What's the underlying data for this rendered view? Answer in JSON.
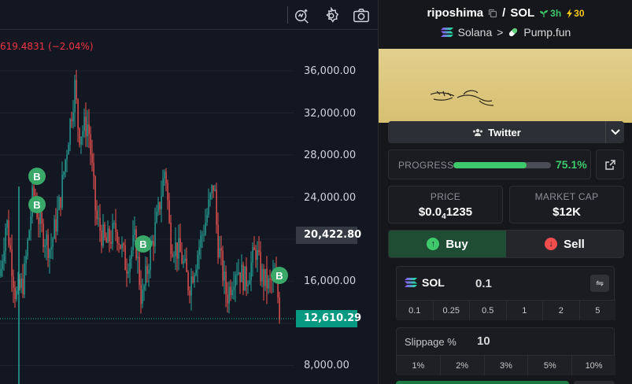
{
  "chart": {
    "ohlc_change": "619.4831 (−2.04%)",
    "axis_ticks": [
      "36,000.00",
      "32,000.00",
      "28,000.00",
      "24,000.00",
      "16,000.00",
      "8,000.00"
    ],
    "crosshair_price": "20,422.80",
    "last_price": "12,610.29",
    "buy_marker": "B",
    "colors": {
      "up": "#26a69a",
      "down": "#ef5350",
      "marker": "#3aa869",
      "last_price_tag": "#089981"
    },
    "toolbar_icons": [
      "indicators-icon",
      "settings-icon",
      "screenshot-icon"
    ]
  },
  "token": {
    "name": "riposhima",
    "separator": "/",
    "pair": "SOL",
    "age": "3h",
    "boost": "30",
    "chain": "Solana",
    "breadcrumb_sep": ">",
    "platform": "Pump.fun"
  },
  "social": {
    "twitter_label": "Twitter"
  },
  "progress": {
    "label": "PROGRESS",
    "percent_text": "75.1%",
    "fraction": 0.751
  },
  "stats": {
    "price_label": "PRICE",
    "price_prefix": "$0.0",
    "price_zeros": "4",
    "price_digits": "1235",
    "mcap_label": "MARKET CAP",
    "mcap_value": "$12K"
  },
  "trade": {
    "buy_label": "Buy",
    "sell_label": "Sell",
    "amount_token": "SOL",
    "amount_value": "0.1",
    "quick_amounts": [
      "0.1",
      "0.25",
      "0.5",
      "1",
      "2",
      "5"
    ],
    "slippage_label": "Slippage %",
    "slippage_value": "10",
    "slippage_options": [
      "1%",
      "2%",
      "3%",
      "5%",
      "10%"
    ]
  }
}
